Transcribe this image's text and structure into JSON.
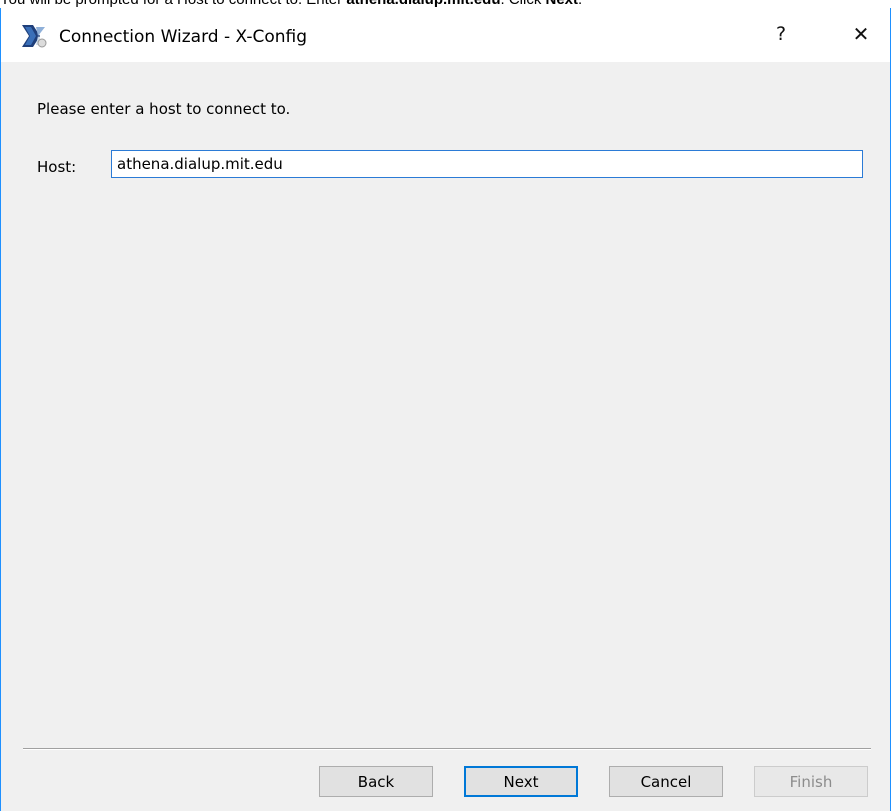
{
  "caption": {
    "text_before": "You will be prompted for a Host to connect to. Enter ",
    "host_bold": "athena.dialup.mit.edu",
    "text_middle": ". Click ",
    "next_bold": "Next",
    "text_after": "."
  },
  "window": {
    "title": "Connection Wizard - X-Config",
    "help_label": "?",
    "close_label": "✕"
  },
  "main": {
    "prompt": "Please enter a host to connect to.",
    "host_label": "Host:",
    "host_value": "athena.dialup.mit.edu"
  },
  "buttons": {
    "back": "Back",
    "next": "Next",
    "cancel": "Cancel",
    "finish": "Finish"
  },
  "colors": {
    "window_border": "#1e90ff",
    "focus_blue": "#0078d7",
    "dialog_bg": "#f0f0f0"
  },
  "icons": {
    "app": "x-config-logo-icon",
    "help": "help-icon",
    "close": "close-icon"
  }
}
